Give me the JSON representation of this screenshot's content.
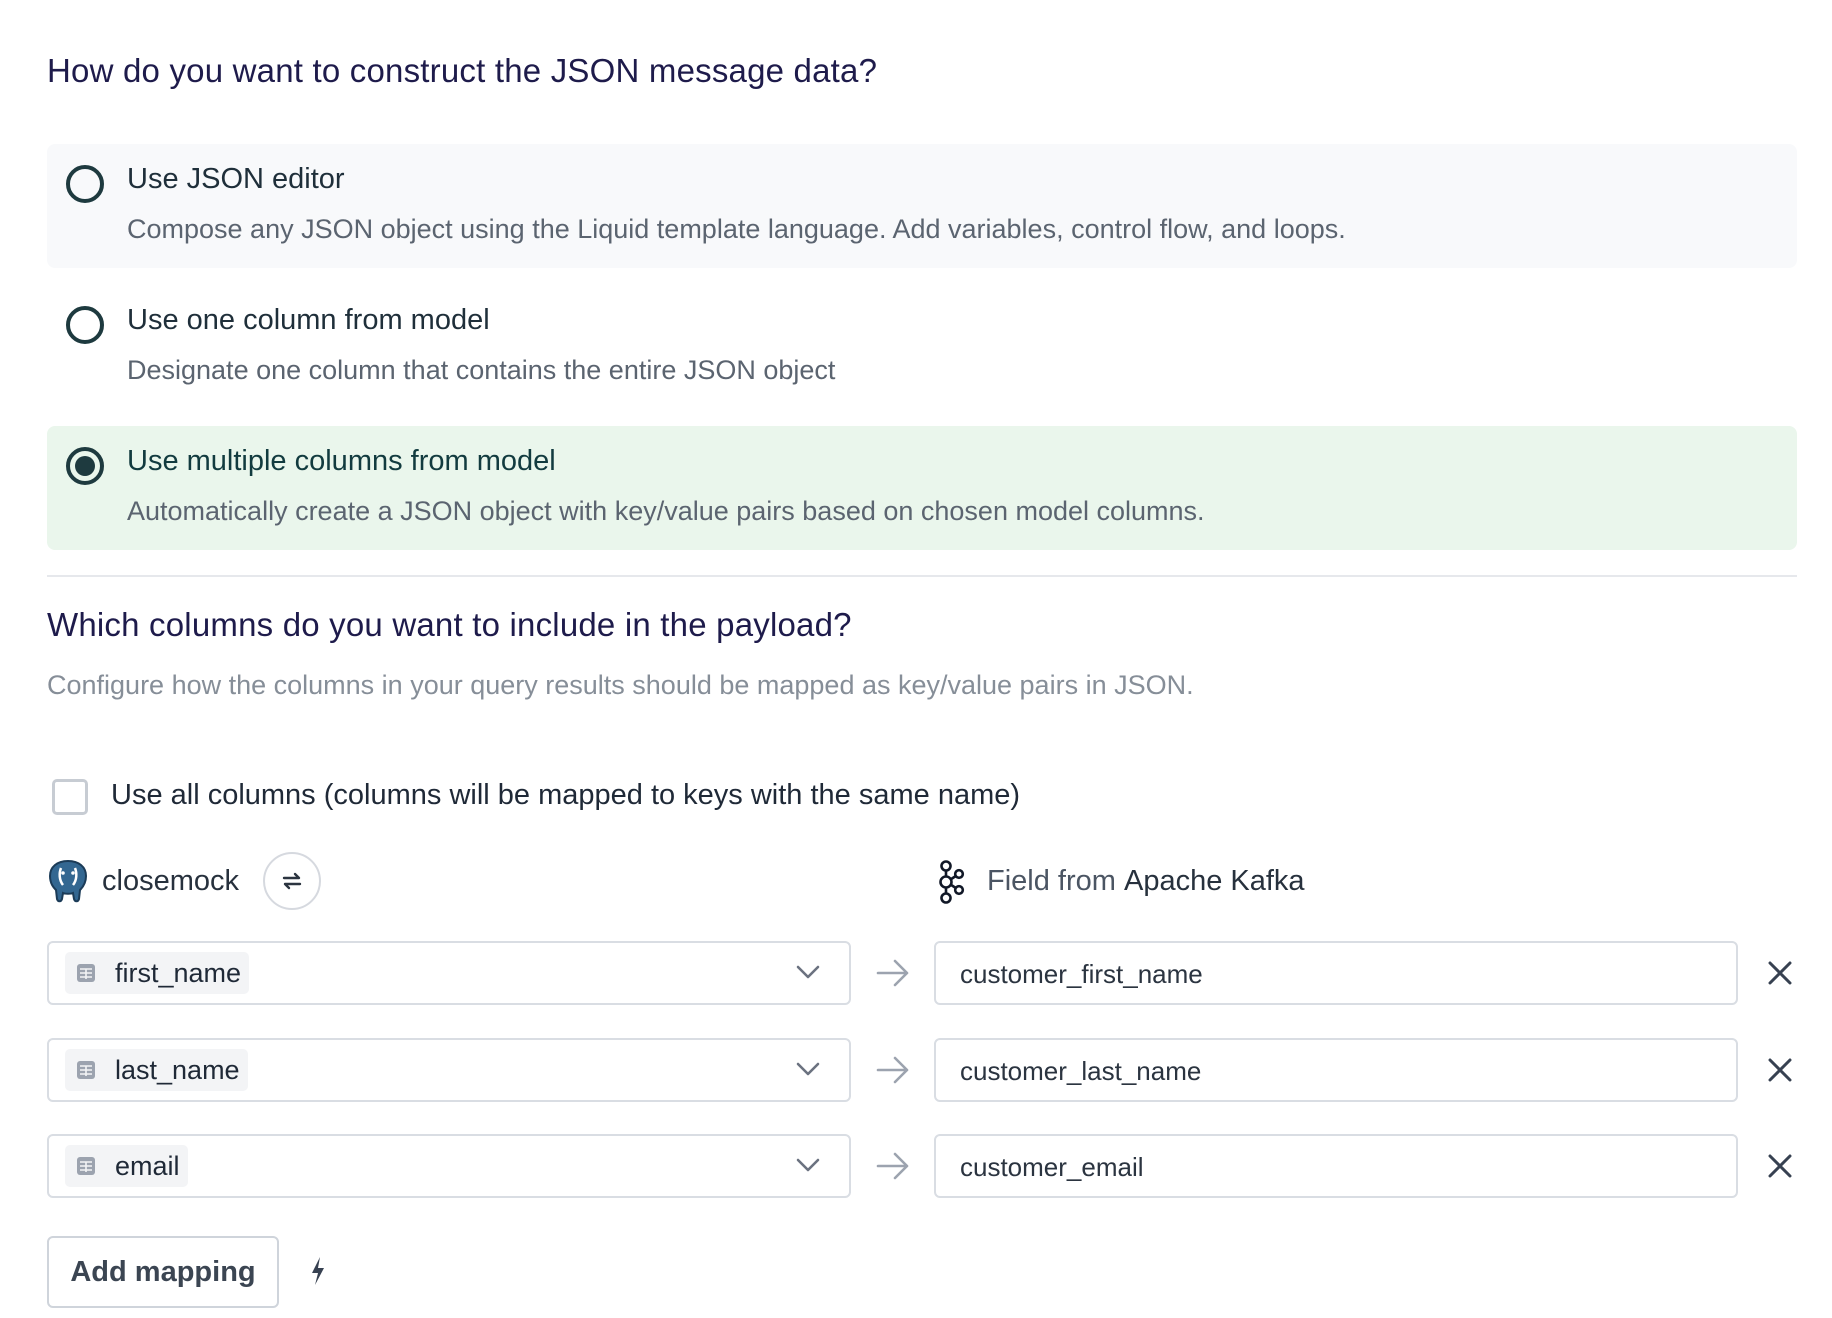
{
  "format_question": "How do you want to construct the JSON message data?",
  "options": [
    {
      "title": "Use JSON editor",
      "description": "Compose any JSON object using the Liquid template language. Add variables, control flow, and loops.",
      "selected": false
    },
    {
      "title": "Use one column from model",
      "description": "Designate one column that contains the entire JSON object",
      "selected": false
    },
    {
      "title": "Use multiple columns from model",
      "description": "Automatically create a JSON object with key/value pairs based on chosen model columns.",
      "selected": true
    }
  ],
  "columns_section": {
    "title": "Which columns do you want to include in the payload?",
    "description": "Configure how the columns in your query results should be mapped as key/value pairs in JSON.",
    "use_all_label": "Use all columns (columns will be mapped to keys with the same name)",
    "use_all_checked": false
  },
  "source": {
    "name": "closemock",
    "icon": "postgresql-elephant-icon"
  },
  "destination": {
    "prefix": "Field from",
    "name": "Apache Kafka",
    "icon": "kafka-icon"
  },
  "mappings": [
    {
      "source_column": "first_name",
      "dest_field": "customer_first_name"
    },
    {
      "source_column": "last_name",
      "dest_field": "customer_last_name"
    },
    {
      "source_column": "email",
      "dest_field": "customer_email"
    }
  ],
  "add_mapping_label": "Add mapping",
  "colors": {
    "selected_bg": "#eaf6ec",
    "radio": "#1e3a3f",
    "heading": "#1e1b4b"
  }
}
